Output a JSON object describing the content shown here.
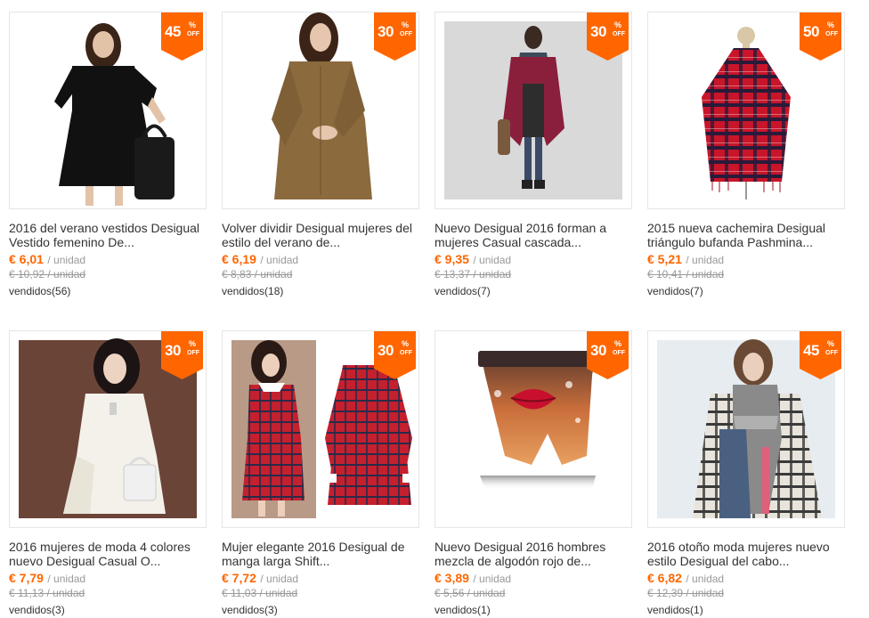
{
  "products": [
    {
      "discount": "45",
      "pct": "%",
      "off": "OFF",
      "title": "2016 del verano vestidos Desigual\nVestido femenino De...",
      "price": "€ 6,01",
      "unit": "/ unidad",
      "old_price": "€ 10,92 / unidad",
      "sold": "vendidos(56)",
      "image": "black-dress-photo"
    },
    {
      "discount": "30",
      "pct": "%",
      "off": "OFF",
      "title": "Volver dividir Desigual mujeres del\nestilo del verano de...",
      "price": "€ 6,19",
      "unit": "/ unidad",
      "old_price": "€ 8,83 / unidad",
      "sold": "vendidos(18)",
      "image": "brown-blouse-photo"
    },
    {
      "discount": "30",
      "pct": "%",
      "off": "OFF",
      "title": "Nuevo Desigual 2016 forman a\nmujeres Casual cascada...",
      "price": "€ 9,35",
      "unit": "/ unidad",
      "old_price": "€ 13,37 / unidad",
      "sold": "vendidos(7)",
      "image": "burgundy-cardigan-photo"
    },
    {
      "discount": "50",
      "pct": "%",
      "off": "OFF",
      "title": "2015 nueva cachemira Desigual\ntriángulo bufanda Pashmina...",
      "price": "€ 5,21",
      "unit": "/ unidad",
      "old_price": "€ 10,41 / unidad",
      "sold": "vendidos(7)",
      "image": "plaid-poncho-photo"
    },
    {
      "discount": "30",
      "pct": "%",
      "off": "OFF",
      "title": "2016 mujeres de moda 4 colores\nnuevo Desigual Casual O...",
      "price": "€ 7,79",
      "unit": "/ unidad",
      "old_price": "€ 11,13 / unidad",
      "sold": "vendidos(3)",
      "image": "white-lace-dress-photo"
    },
    {
      "discount": "30",
      "pct": "%",
      "off": "OFF",
      "title": "Mujer elegante 2016 Desigual de\nmanga larga Shift...",
      "price": "€ 7,72",
      "unit": "/ unidad",
      "old_price": "€ 11,03 / unidad",
      "sold": "vendidos(3)",
      "image": "red-plaid-dress-photo"
    },
    {
      "discount": "30",
      "pct": "%",
      "off": "OFF",
      "title": "Nuevo Desigual 2016 hombres\nmezcla de algodón rojo de...",
      "price": "€ 3,89",
      "unit": "/ unidad",
      "old_price": "€ 5,56 / unidad",
      "sold": "vendidos(1)",
      "image": "lips-boxer-photo"
    },
    {
      "discount": "45",
      "pct": "%",
      "off": "OFF",
      "title": "2016 otoño moda mujeres nuevo\nestilo Desigual del cabo...",
      "price": "€ 6,82",
      "unit": "/ unidad",
      "old_price": "€ 12,39 / unidad",
      "sold": "vendidos(1)",
      "image": "plaid-scarf-photo"
    }
  ],
  "colors": {
    "accent": "#ff6600",
    "price": "#ff6600",
    "muted": "#999999",
    "text": "#333333",
    "border": "#e6e6e6"
  }
}
